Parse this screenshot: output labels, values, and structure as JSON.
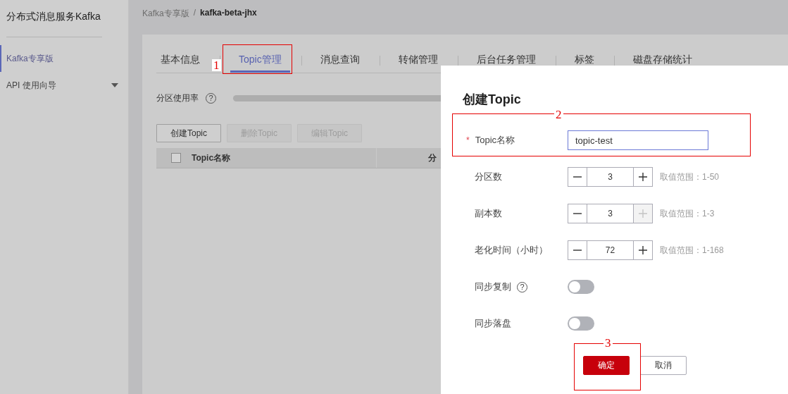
{
  "sidebar": {
    "title": "分布式消息服务Kafka",
    "items": [
      {
        "label": "Kafka专享版",
        "kind": "link",
        "selected": true
      },
      {
        "label": "API 使用向导",
        "kind": "group",
        "selected": false,
        "expanded": false
      }
    ]
  },
  "breadcrumb": {
    "separator": "/",
    "items": [
      "Kafka专享版",
      "kafka-beta-jhx"
    ]
  },
  "tabs": [
    {
      "label": "基本信息",
      "selected": false
    },
    {
      "label": "Topic管理",
      "selected": true
    },
    {
      "label": "消息查询",
      "selected": false
    },
    {
      "label": "转储管理",
      "selected": false
    },
    {
      "label": "后台任务管理",
      "selected": false
    },
    {
      "label": "标签",
      "selected": false
    },
    {
      "label": "磁盘存储统计",
      "selected": false
    }
  ],
  "usage": {
    "label": "分区使用率",
    "help": "?"
  },
  "toolbar": [
    {
      "label": "创建Topic",
      "disabled": false
    },
    {
      "label": "删除Topic",
      "disabled": true
    },
    {
      "label": "编辑Topic",
      "disabled": true
    }
  ],
  "table": {
    "select_all": {
      "checked": false
    },
    "columns": [
      "Topic名称",
      "分"
    ]
  },
  "dialog": {
    "title": "创建Topic",
    "fields": [
      {
        "kind": "text",
        "label": "Topic名称",
        "required_mark": "*",
        "value": "topic-test",
        "focused": true
      },
      {
        "kind": "stepper",
        "label": "分区数",
        "value": "3",
        "plus_disabled": false,
        "hint": "取值范围：1-50"
      },
      {
        "kind": "stepper",
        "label": "副本数",
        "value": "3",
        "plus_disabled": true,
        "hint": "取值范围：1-3"
      },
      {
        "kind": "stepper",
        "label": "老化时间（小时）",
        "value": "72",
        "plus_disabled": false,
        "hint": "取值范围：1-168"
      },
      {
        "kind": "switch",
        "label": "同步复制",
        "help": "?",
        "on": false
      },
      {
        "kind": "switch",
        "label": "同步落盘",
        "on": false
      }
    ],
    "buttons": [
      {
        "label": "确定",
        "kind": "primary"
      },
      {
        "label": "取消",
        "kind": "secondary"
      }
    ]
  },
  "annotations": [
    {
      "label": "1"
    },
    {
      "label": "2"
    },
    {
      "label": "3"
    }
  ]
}
